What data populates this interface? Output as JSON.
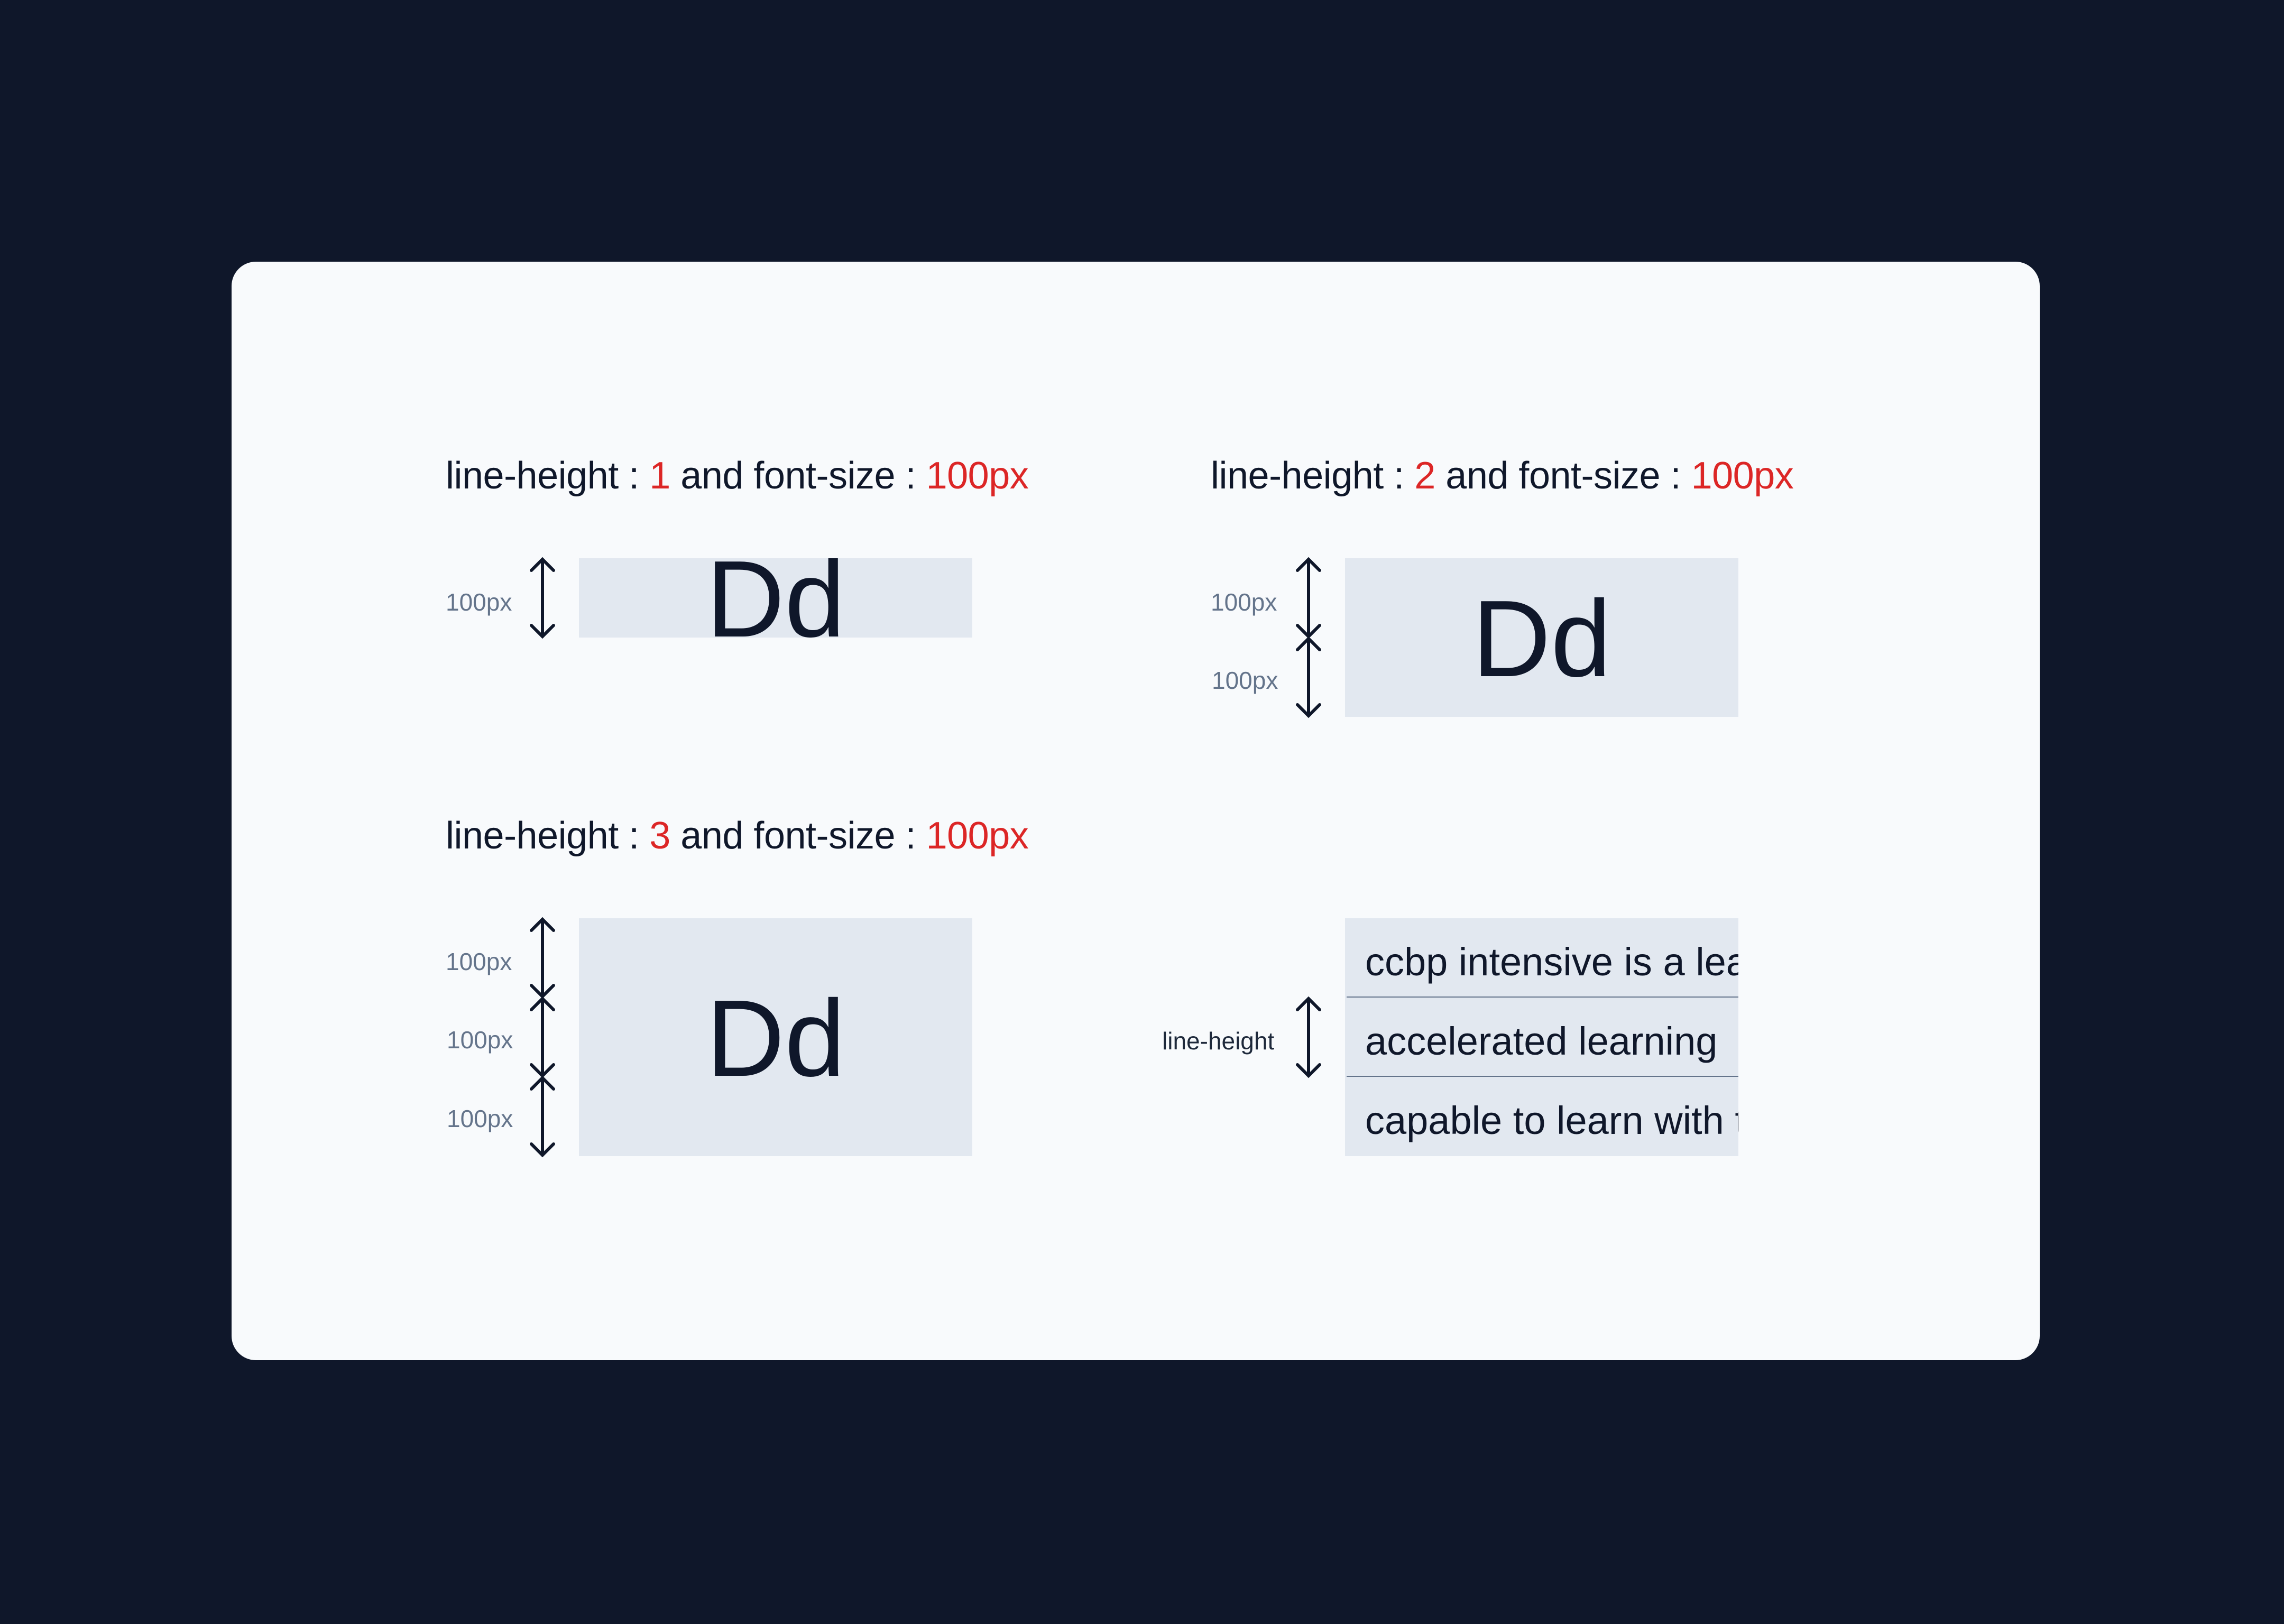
{
  "colors": {
    "background": "#0f172a",
    "card": "#f8fafc",
    "box": "#e2e8f0",
    "text": "#0f172a",
    "highlight": "#dc2626",
    "dimension_label": "#64748b"
  },
  "examples": [
    {
      "title": {
        "prefix": "line-height : ",
        "line_height_value": "1",
        "middle": " and font-size : ",
        "font_size_value": "100px"
      },
      "sample_text": "Dd",
      "line_height_multiplier": 1,
      "dimension_labels": [
        "100px"
      ]
    },
    {
      "title": {
        "prefix": "line-height : ",
        "line_height_value": "2",
        "middle": " and font-size : ",
        "font_size_value": "100px"
      },
      "sample_text": "Dd",
      "line_height_multiplier": 2,
      "dimension_labels": [
        "100px",
        "100px"
      ]
    },
    {
      "title": {
        "prefix": "line-height : ",
        "line_height_value": "3",
        "middle": " and font-size : ",
        "font_size_value": "100px"
      },
      "sample_text": "Dd",
      "line_height_multiplier": 3,
      "dimension_labels": [
        "100px",
        "100px",
        "100px"
      ]
    }
  ],
  "paragraph_example": {
    "label": "line-height",
    "lines": [
      "ccbp intensive is a lea",
      "accelerated learning",
      "capable to learn with t"
    ]
  }
}
